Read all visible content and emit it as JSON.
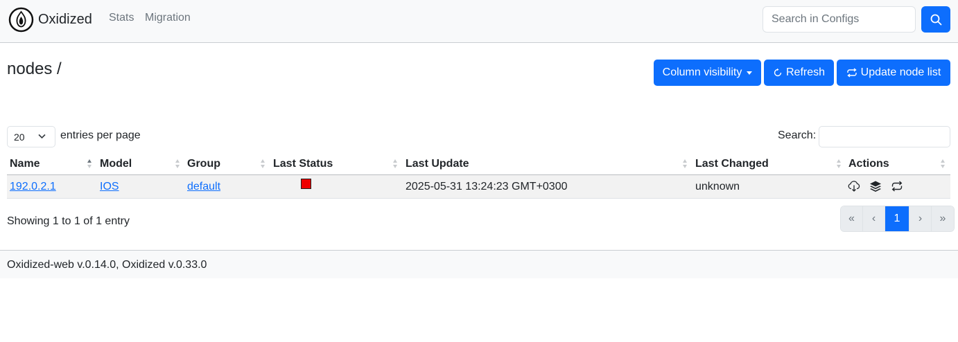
{
  "navbar": {
    "brand": "Oxidized",
    "links": [
      "Stats",
      "Migration"
    ],
    "search_placeholder": "Search in Configs"
  },
  "page": {
    "title": "nodes /",
    "buttons": {
      "column_visibility": "Column visibility",
      "refresh": "Refresh",
      "update_node_list": "Update node list"
    }
  },
  "table_controls": {
    "page_length": "20",
    "page_length_label": "entries per page",
    "search_label": "Search:"
  },
  "table": {
    "columns": [
      "Name",
      "Model",
      "Group",
      "Last Status",
      "Last Update",
      "Last Changed",
      "Actions"
    ],
    "rows": [
      {
        "name": "192.0.2.1",
        "model": "IOS",
        "group": "default",
        "last_status": "fail",
        "last_status_color": "#ee0000",
        "last_update": "2025-05-31 13:24:23 GMT+0300",
        "last_changed": "unknown",
        "actions": [
          "cloud-download-icon",
          "layers-icon",
          "repeat-icon"
        ]
      }
    ]
  },
  "table_info": "Showing 1 to 1 of 1 entry",
  "pagination": {
    "first": "«",
    "previous": "‹",
    "current": "1",
    "next": "›",
    "last": "»"
  },
  "footer": {
    "version": "Oxidized-web v.0.14.0, Oxidized v.0.33.0"
  },
  "colors": {
    "primary": "#0d6efd",
    "navbar_bg": "#f8f9fa",
    "status_fail": "#ee0000"
  }
}
